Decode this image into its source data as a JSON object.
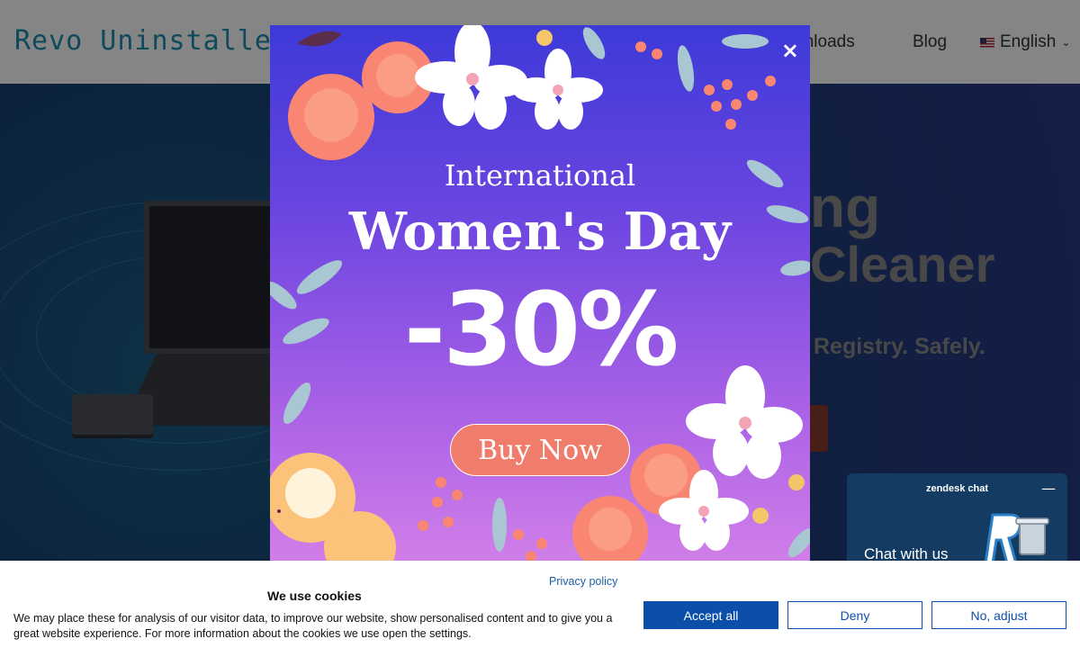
{
  "header": {
    "logo_text": "Revo Uninstaller",
    "nav": {
      "downloads": "wnloads",
      "blog": "Blog",
      "language": "English"
    }
  },
  "hero": {
    "title_line1": "ng",
    "title_line2": "Cleaner",
    "subtitle": "Registry. Safely."
  },
  "promo": {
    "line1": "International",
    "line2": "Women's Day",
    "discount": "-30%",
    "buy_label": "Buy Now",
    "close_symbol": "×"
  },
  "chat": {
    "brand": "zendesk chat",
    "minimize_symbol": "—",
    "label": "Chat with us"
  },
  "cookie": {
    "title": "We use cookies",
    "text": "We may place these for analysis of our visitor data, to improve our website, show personalised content and to give you a great website experience. For more information about the cookies we use open the settings.",
    "privacy_link": "Privacy policy",
    "accept_label": "Accept all",
    "deny_label": "Deny",
    "adjust_label": "No, adjust"
  },
  "colors": {
    "accent_blue": "#0b4faa",
    "promo_button": "#f07c6b",
    "chat_bg": "#143b62",
    "logo": "#1b8fb0"
  }
}
